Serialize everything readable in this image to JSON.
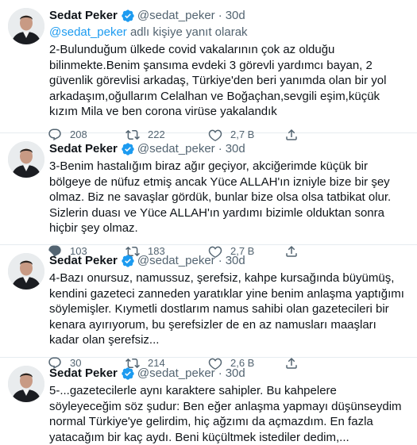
{
  "colors": {
    "accent": "#1d9bf0",
    "muted": "#536471",
    "text": "#0f1419",
    "divider": "#e6ecf0"
  },
  "icons": {
    "verified": "verified-badge-icon",
    "reply": "reply-icon",
    "retweet": "retweet-icon",
    "like": "heart-icon",
    "share": "share-icon"
  },
  "tweets": [
    {
      "name": "Sedat Peker",
      "handle": "@sedat_peker",
      "dot": "·",
      "time": "30d",
      "reply_mention": "@sedat_peker",
      "reply_suffix": " adlı kişiye yanıt olarak",
      "text": "2-Bulunduğum ülkede covid vakalarının çok az olduğu bilinmekte.Benim şansıma evdeki 3 görevli yardımcı bayan, 2 güvenlik görevlisi arkadaş, Türkiye'den beri yanımda olan bir yol arkadaşım,oğullarım Celalhan ve Boğaçhan,sevgili eşim,küçük kızım Mila ve ben corona virüse yakalandık",
      "replies": "208",
      "retweets": "222",
      "likes": "2,7 B"
    },
    {
      "name": "Sedat Peker",
      "handle": "@sedat_peker",
      "dot": "·",
      "time": "30d",
      "text": "3-Benim hastalığım biraz ağır geçiyor, akciğerimde küçük bir bölgeye de nüfuz etmiş ancak Yüce ALLAH'ın izniyle bize bir şey olmaz. Biz ne savaşlar gördük, bunlar bize olsa olsa tatbikat olur. Sizlerin duası ve Yüce ALLAH'ın yardımı bizimle olduktan sonra hiçbir şey olmaz.",
      "replies": "103",
      "retweets": "183",
      "likes": "2,7 B"
    },
    {
      "name": "Sedat Peker",
      "handle": "@sedat_peker",
      "dot": "·",
      "time": "30d",
      "text": "4-Bazı onursuz, namussuz, şerefsiz, kahpe kursağında büyümüş, kendini gazeteci zanneden yaratıklar yine benim anlaşma yaptığımı söylemişler. Kıymetli dostlarım namus sahibi olan gazetecileri bir kenara ayırıyorum, bu şerefsizler de en az namusları maaşları kadar olan şerefsiz...",
      "replies": "30",
      "retweets": "214",
      "likes": "2,6 B"
    },
    {
      "name": "Sedat Peker",
      "handle": "@sedat_peker",
      "dot": "·",
      "time": "30d",
      "text": "5-...gazetecilerle aynı karaktere sahipler. Bu kahpelere söyleyeceğim söz şudur: Ben eğer anlaşma yapmayı düşünseydim normal Türkiye'ye gelirdim, hiç ağzımı da açmazdım. En fazla yatacağım bir kaç aydı. Beni küçültmek istediler dedim,..."
    }
  ]
}
